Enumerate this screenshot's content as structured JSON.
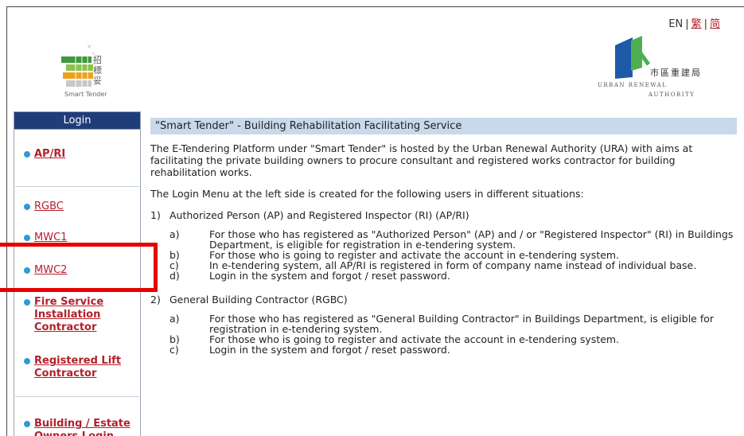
{
  "header": {
    "lang_en": "EN",
    "lang_sep1": "|",
    "lang_tc": "繁",
    "lang_sep2": "|",
    "lang_sc": "简",
    "smart_tender_logo": {
      "chinese": "招標妥",
      "text": "Smart Tender"
    },
    "ura_logo": {
      "chinese": "市區重建局",
      "line1": "URBAN RENEWAL",
      "line2": "AUTHORITY"
    }
  },
  "sidebar": {
    "title": "Login",
    "items": [
      {
        "label": "AP/RI"
      },
      {
        "label": "RGBC"
      },
      {
        "label": "MWC1"
      },
      {
        "label": "MWC2"
      },
      {
        "label": "Fire Service Installation Contractor"
      },
      {
        "label": "Registered Lift Contractor"
      },
      {
        "label": "Building / Estate Owners Login"
      }
    ]
  },
  "main": {
    "title": "\"Smart Tender\" - Building Rehabilitation Facilitating Service",
    "intro": "The E-Tendering Platform under \"Smart Tender\" is hosted by the Urban Renewal Authority (URA) with aims at facilitating the private building owners to procure consultant and registered works contractor for building rehabilitation works.",
    "menu_intro": "The Login Menu at the left side is created for the following users in different situations:",
    "sections": [
      {
        "num": "1)",
        "title": "Authorized Person (AP) and Registered Inspector (RI) (AP/RI)",
        "items": [
          {
            "letter": "a)",
            "text": "For those who has registered as \"Authorized Person\" (AP) and / or \"Registered Inspector\" (RI) in Buildings Department, is eligible for registration in e-tendering system."
          },
          {
            "letter": "b)",
            "text": "For those who is going to register and activate the account in e-tendering system."
          },
          {
            "letter": "c)",
            "text": "In e-tendering system, all AP/RI is registered in form of company name instead of individual base."
          },
          {
            "letter": "d)",
            "text": "Login in the system and forgot / reset password."
          }
        ]
      },
      {
        "num": "2)",
        "title": "General Building Contractor (RGBC)",
        "items": [
          {
            "letter": "a)",
            "text": "For those who has registered as \"General Building Contractor\" in Buildings Department, is eligible for registration in e-tendering system."
          },
          {
            "letter": "b)",
            "text": "For those who is going to register and activate the account in e-tendering system."
          },
          {
            "letter": "c)",
            "text": "Login in the system and forgot / reset password."
          }
        ]
      }
    ]
  },
  "colors": {
    "link_red": "#b3202a",
    "sidebar_header": "#1f3d7a",
    "title_bar": "#c7d9ea",
    "bullet": "#2e9bd6",
    "highlight": "#e60000"
  }
}
